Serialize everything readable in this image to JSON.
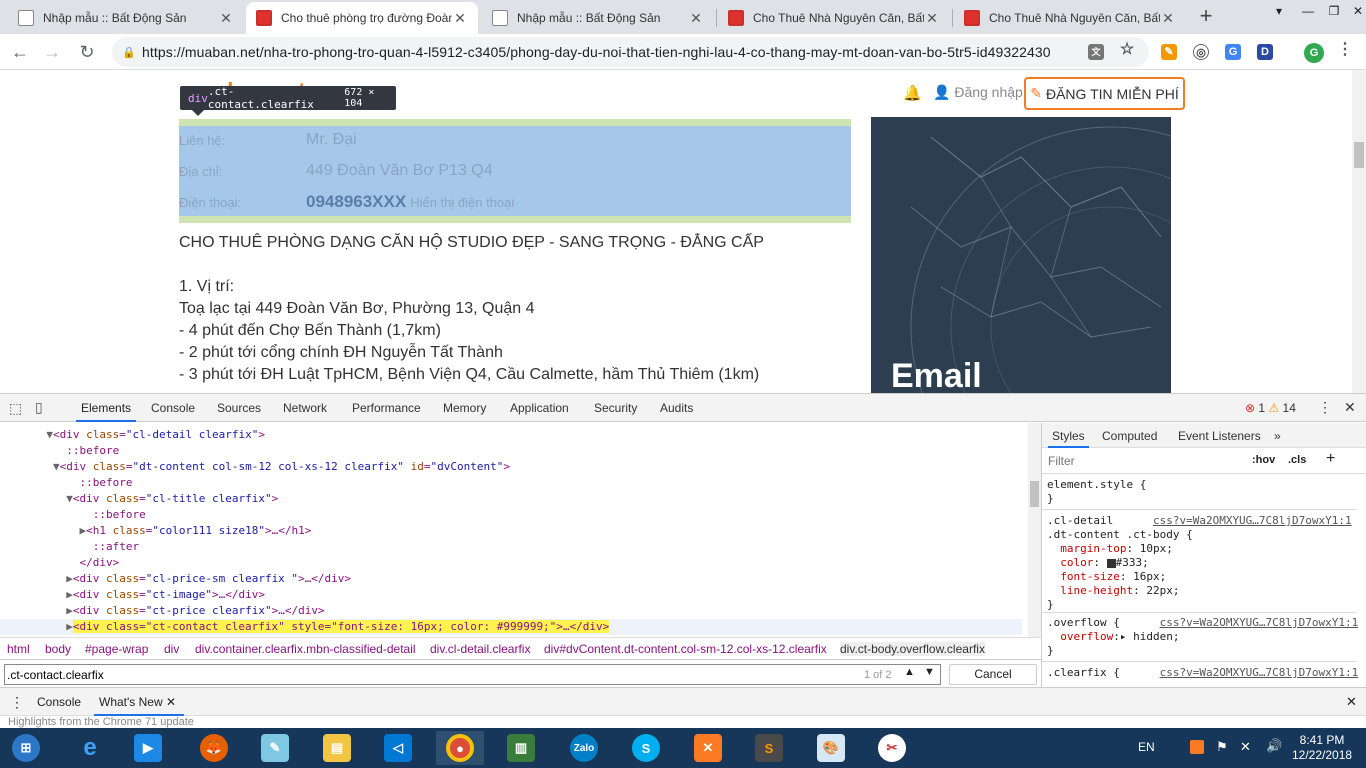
{
  "browser": {
    "tabs": [
      {
        "title": "Nhập mẫu :: Bất Động Sản",
        "icon": "document-icon",
        "active": false
      },
      {
        "title": "Cho thuê phòng trọ đường Đoàn V",
        "icon": "muaban-icon",
        "active": true
      },
      {
        "title": "Nhập mẫu :: Bất Động Sản",
        "icon": "document-icon",
        "active": false
      },
      {
        "title": "Cho Thuê Nhà Nguyên Căn, Bất Đô",
        "icon": "muaban-icon",
        "active": false
      },
      {
        "title": "Cho Thuê Nhà Nguyên Căn, Bất Độ",
        "icon": "muaban-icon",
        "active": false
      }
    ],
    "url": "https://muaban.net/nha-tro-phong-tro-quan-4-l5912-c3405/phong-day-du-noi-that-tien-nghi-lau-4-co-thang-may-mt-doan-van-bo-5tr5-id49322430",
    "profile_initial": "G",
    "ext_d": "D"
  },
  "page": {
    "logo": "muaban.net",
    "login": "Đăng nhập",
    "post_button": "ĐĂNG TIN MIỄN PHÍ",
    "tooltip": {
      "selector": "div",
      "classes": ".ct-contact.clearfix",
      "dims": "672 × 104"
    },
    "contact": {
      "rows": [
        {
          "label": "Liên hệ:",
          "value": "Mr. Đại"
        },
        {
          "label": "Địa chỉ:",
          "value": "449 Đoàn Văn Bơ P13 Q4"
        },
        {
          "label": "Điện thoại:",
          "value": "0948963XXX",
          "extra": "Hiển thị điện thoại"
        }
      ]
    },
    "body_lines": [
      "CHO THUÊ PHÒNG DẠNG CĂN HỘ STUDIO ĐẸP - SANG TRỌNG - ĐẲNG CẤP",
      "",
      "1. Vị trí:",
      "Toạ lạc tại 449 Đoàn Văn Bơ, Phường 13, Quận 4",
      "- 4 phút đến Chợ Bến Thành (1,7km)",
      "- 2 phút tới cổng chính ĐH Nguyễn Tất Thành",
      "- 3 phút tới ĐH Luật TpHCM, Bệnh Viện Q4, Cầu Calmette, hầm Thủ Thiêm (1km)"
    ],
    "banner_text": "Email"
  },
  "devtools": {
    "tabs": [
      "Elements",
      "Console",
      "Sources",
      "Network",
      "Performance",
      "Memory",
      "Application",
      "Security",
      "Audits"
    ],
    "errors": "1",
    "warnings": "14",
    "breadcrumbs": [
      "html",
      "body",
      "#page-wrap",
      "div",
      "div.container.clearfix.mbn-classified-detail",
      "div.cl-detail.clearfix",
      "div#dvContent.dt-content.col-sm-12.col-xs-12.clearfix",
      "div.ct-body.overflow.clearfix"
    ],
    "find_value": ".ct-contact.clearfix",
    "find_count": "1 of 2",
    "cancel": "Cancel",
    "styles_tabs": [
      "Styles",
      "Computed",
      "Event Listeners"
    ],
    "filter_placeholder": "Filter",
    "hov": ":hov",
    "cls": ".cls",
    "element_style": "element.style {",
    "drawer_tabs": [
      "Console",
      "What's New"
    ],
    "drawer_text": "Highlights from the Chrome 71 update"
  },
  "taskbar": {
    "lang": "EN",
    "time": "8:41 PM",
    "date": "12/22/2018"
  }
}
